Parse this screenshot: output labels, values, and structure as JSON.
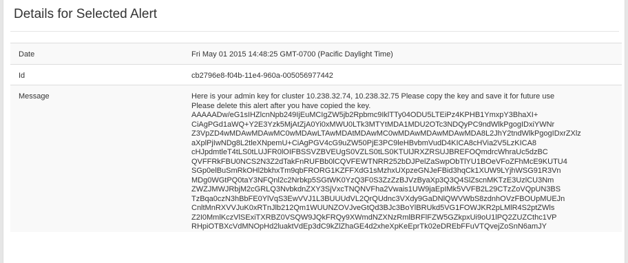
{
  "panel": {
    "title": "Details for Selected Alert"
  },
  "fields": {
    "date": {
      "label": "Date",
      "value": "Fri May 01 2015 14:48:25 GMT-0700 (Pacific Daylight Time)"
    },
    "id": {
      "label": "Id",
      "value": "cb2796e8-f04b-11e4-960a-005056977442"
    },
    "message": {
      "label": "Message",
      "lines": [
        "Here is your admin key for cluster 10.238.32.74, 10.238.32.75 Please copy the key and save it for future use",
        "Please delete this alert after you have copied the key.",
        "AAAAADw/eG1sIHZlcnNpb249IjEuMCIgZW5jb2Rpbmc9IklTTy04ODU5LTEiPz4KPHB1YmxpY3BhaXI+",
        "CiAgPGd1aWQ+Y2E3Yzk5MjAtZjA0Yi0xMWU0LTk3MTYtMDA1MDU2OTc3NDQyPC9ndWlkPgogIDxiYWNr",
        "Z3VpZD4wMDAwMDAwMC0wMDAwLTAwMDAtMDAwMC0wMDAwMDAwMDAwMDA8L2JhY2tndWlkPgogIDxrZXlz",
        "aXplPjIwNDg8L2tleXNpemU+CiAgPGV4cG9uZW50PjE3PC9leHBvbmVudD4KICA8cHVia2V5LzKICA8",
        "cHJpdmtleT4tLS0tLUJFR0lOIFBSSVZBVEUgS0VZLS0tLS0KTUlJRXZRSUJBREFOQmdrcWhraUc5dzBC",
        "QVFFRkFBU0NCS2N3Z2dTakFnRUFBb0lCQVFEWTNRR252bDJPelZaSwpObTlYU1BOeVFoZFhMcE9KUTU4",
        "SGp0elBuSmRkOHl2bkhxTm9qbFRORG1KZFFXdG1sMzhxUXpzeGNJeFBid3hqCk1XUW9LYjhWSG91R3Vn",
        "MDg0WGtPQ0taY3NFQnl2c2Nrbkp5SGtWK0YzQ3F0S3ZzZzBJVzByaXp3Q3Q4SlZscnMKTzE3UzlCU3Nm",
        "ZWZJMWJRbjM2cGRLQ3NvbkdnZXY3SjVxcTNQNVFha2Vwais1UW9jaEpIMk5VVFB2L29CTzZoVQpUN3BS",
        "TzBqa0czN3hBbFE0YlVqS3EwVVJ1L3BUUUdVL2QrQUdnc3VXdy9GaDNlQWVWbS8zdnhOVzFBOUpMUEJn",
        "CnltMnRXVVJuK0xRTnJlb212Qm1WUUNZOVJveGtQd3BJc3BoYlBRUkd5VG1FOWJKR2pLMlR4S2ptZWls",
        "Z2I0MmlKczVlSExiTXRBZ0VSQW9JQkFRQy9XWmdNZXNzRmlBRFlFZW5GZkpxUi9oU1lPQ2ZUZCthc1VP",
        "RHpiOTBXcVdMNOpHd2luaktVdEp3dC9kZlZhaGE4d2xheXpKeEprTk02eDREbFFuVTQvejZoSnN6amJY"
      ]
    }
  }
}
